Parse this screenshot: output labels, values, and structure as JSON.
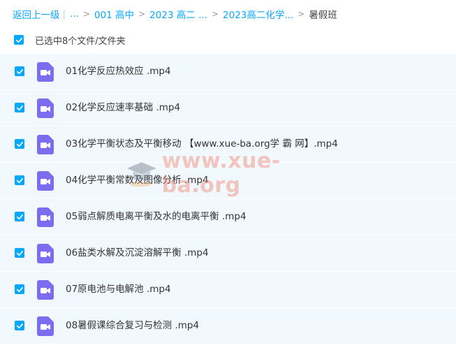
{
  "breadcrumb": {
    "back": "返回上一级",
    "ellipsis": "...",
    "items": [
      "001 高中",
      "2023 高二 ...",
      "2023高二化学..."
    ],
    "current": "暑假班"
  },
  "selection": {
    "label": "已选中8个文件/文件夹"
  },
  "files": [
    {
      "name": "01化学反应热效应 .mp4",
      "checked": true
    },
    {
      "name": "02化学反应速率基础 .mp4",
      "checked": true
    },
    {
      "name": "03化学平衡状态及平衡移动 【www.xue-ba.org学 霸 网】.mp4",
      "checked": true
    },
    {
      "name": "04化学平衡常数及图像分析 .mp4",
      "checked": true
    },
    {
      "name": "05弱点解质电离平衡及水的电离平衡 .mp4",
      "checked": true
    },
    {
      "name": "06盐类水解及沉淀溶解平衡 .mp4",
      "checked": true
    },
    {
      "name": "07原电池与电解池 .mp4",
      "checked": true
    },
    {
      "name": "08暑假课综合复习与检测 .mp4",
      "checked": true
    }
  ],
  "watermark": {
    "text": "www.xue-ba.org"
  },
  "colors": {
    "accent": "#06a7ff",
    "row_bg": "#f2f9fe",
    "video_icon": "#7b6cf0"
  },
  "icons": {
    "file": "video-file-icon",
    "check": "check-icon",
    "watermark": "graduation-cap-icon"
  }
}
